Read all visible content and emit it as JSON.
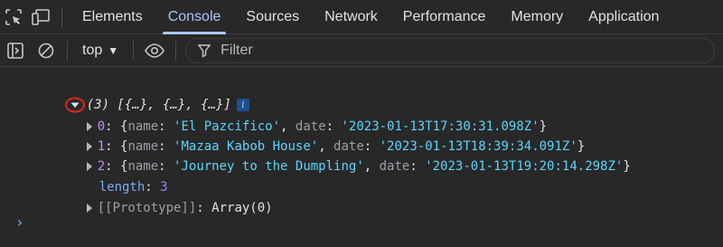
{
  "tabs": [
    {
      "label": "Elements"
    },
    {
      "label": "Console"
    },
    {
      "label": "Sources"
    },
    {
      "label": "Network"
    },
    {
      "label": "Performance"
    },
    {
      "label": "Memory"
    },
    {
      "label": "Application"
    }
  ],
  "active_tab": "Console",
  "toolbar": {
    "context": "top",
    "filter_placeholder": "Filter"
  },
  "console": {
    "summary_prefix": "(3) [{…}, {…}, {…}]",
    "info_badge": "i",
    "items": [
      {
        "index": "0",
        "name": "'El Pazcifico'",
        "date": "'2023-01-13T17:30:31.098Z'"
      },
      {
        "index": "1",
        "name": "'Mazaa Kabob House'",
        "date": "'2023-01-13T18:39:34.091Z'"
      },
      {
        "index": "2",
        "name": "'Journey to the Dumpling'",
        "date": "'2023-01-13T19:20:14.298Z'"
      }
    ],
    "length_label": "length",
    "length_value": "3",
    "prototype_label": "[[Prototype]]",
    "prototype_value": "Array(0)",
    "prompt": "›"
  },
  "colors": {
    "background": "#282828",
    "accent": "#a8c7fa",
    "annotation_red": "#e0281e"
  }
}
